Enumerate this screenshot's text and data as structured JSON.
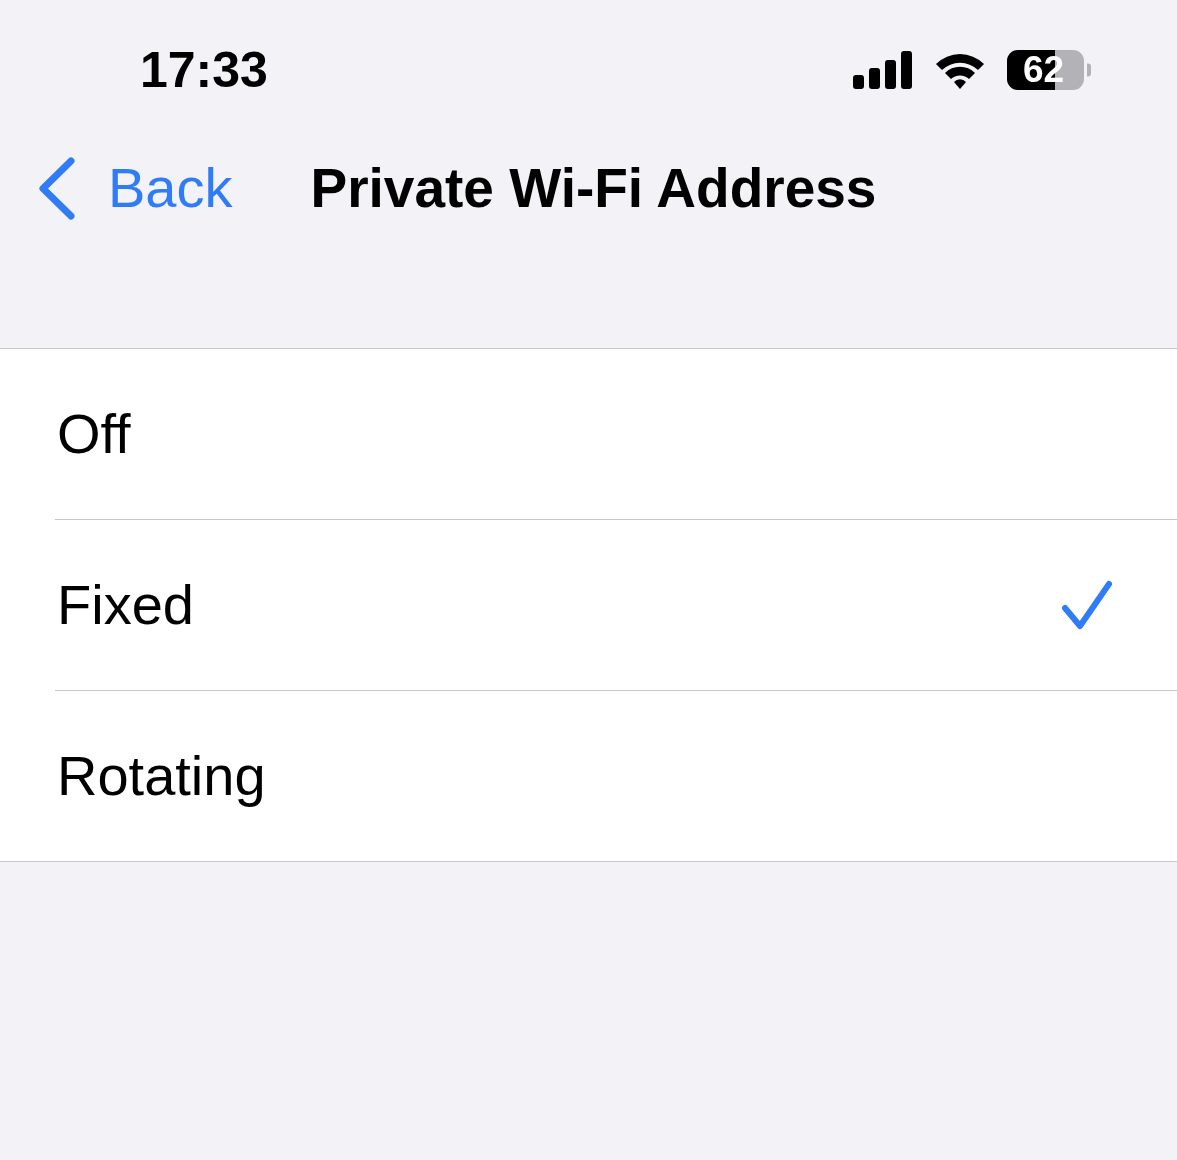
{
  "status_bar": {
    "time": "17:33",
    "battery_percentage": "62"
  },
  "nav_bar": {
    "back_label": "Back",
    "title": "Private Wi-Fi Address"
  },
  "options": [
    {
      "label": "Off",
      "selected": false
    },
    {
      "label": "Fixed",
      "selected": true
    },
    {
      "label": "Rotating",
      "selected": false
    }
  ]
}
